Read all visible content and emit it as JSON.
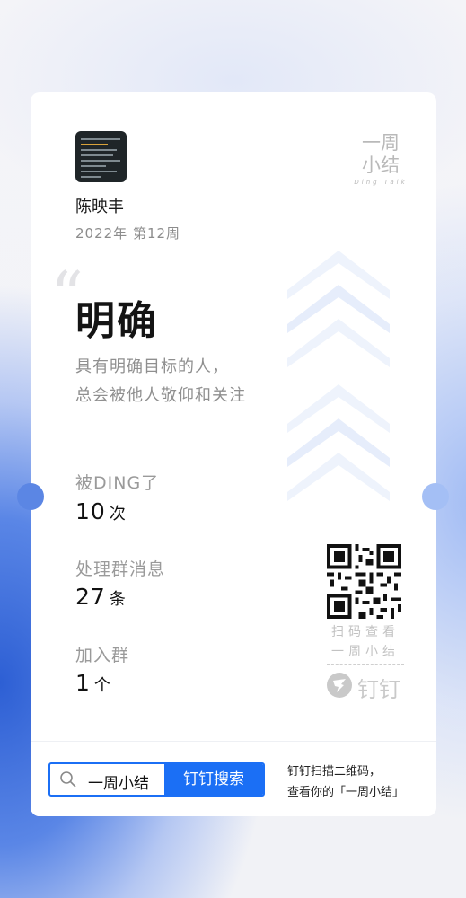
{
  "user": {
    "name": "陈映丰",
    "week": "2022年 第12周"
  },
  "brand": {
    "line1": "一周",
    "line2": "小结",
    "line3": "Ding Talk"
  },
  "quote_mark": "“",
  "keyword": "明确",
  "description": {
    "line1": "具有明确目标的人，",
    "line2": "总会被他人敬仰和关注"
  },
  "stats": [
    {
      "label": "被DING了",
      "value": "10",
      "unit": "次"
    },
    {
      "label": "处理群消息",
      "value": "27",
      "unit": "条"
    },
    {
      "label": "加入群",
      "value": "1",
      "unit": "个"
    }
  ],
  "qr_caption": {
    "line1": "扫码查看",
    "line2": "一周小结"
  },
  "ding_logo_text": "钉钉",
  "footer": {
    "search_text": "一周小结",
    "search_button": "钉钉搜索",
    "note_line1": "钉钉扫描二维码，",
    "note_line2": "查看你的「一周小结」"
  },
  "colors": {
    "accent": "#1b6ff5",
    "muted": "#9a9a9a"
  }
}
